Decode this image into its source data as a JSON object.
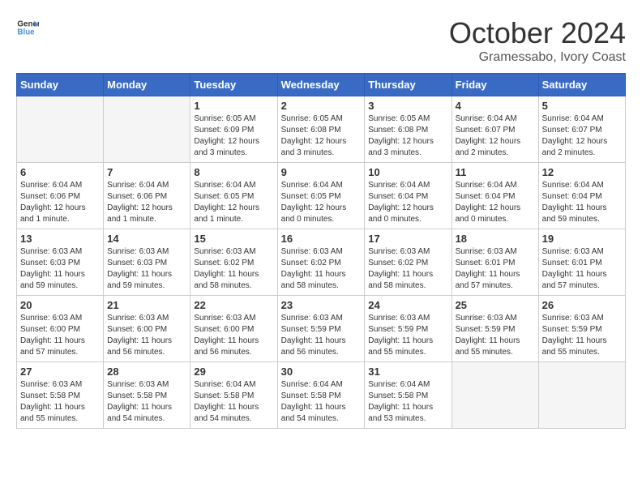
{
  "header": {
    "logo_line1": "General",
    "logo_line2": "Blue",
    "month": "October 2024",
    "location": "Gramessabo, Ivory Coast"
  },
  "weekdays": [
    "Sunday",
    "Monday",
    "Tuesday",
    "Wednesday",
    "Thursday",
    "Friday",
    "Saturday"
  ],
  "weeks": [
    [
      {
        "day": "",
        "info": ""
      },
      {
        "day": "",
        "info": ""
      },
      {
        "day": "1",
        "info": "Sunrise: 6:05 AM\nSunset: 6:09 PM\nDaylight: 12 hours\nand 3 minutes."
      },
      {
        "day": "2",
        "info": "Sunrise: 6:05 AM\nSunset: 6:08 PM\nDaylight: 12 hours\nand 3 minutes."
      },
      {
        "day": "3",
        "info": "Sunrise: 6:05 AM\nSunset: 6:08 PM\nDaylight: 12 hours\nand 3 minutes."
      },
      {
        "day": "4",
        "info": "Sunrise: 6:04 AM\nSunset: 6:07 PM\nDaylight: 12 hours\nand 2 minutes."
      },
      {
        "day": "5",
        "info": "Sunrise: 6:04 AM\nSunset: 6:07 PM\nDaylight: 12 hours\nand 2 minutes."
      }
    ],
    [
      {
        "day": "6",
        "info": "Sunrise: 6:04 AM\nSunset: 6:06 PM\nDaylight: 12 hours\nand 1 minute."
      },
      {
        "day": "7",
        "info": "Sunrise: 6:04 AM\nSunset: 6:06 PM\nDaylight: 12 hours\nand 1 minute."
      },
      {
        "day": "8",
        "info": "Sunrise: 6:04 AM\nSunset: 6:05 PM\nDaylight: 12 hours\nand 1 minute."
      },
      {
        "day": "9",
        "info": "Sunrise: 6:04 AM\nSunset: 6:05 PM\nDaylight: 12 hours\nand 0 minutes."
      },
      {
        "day": "10",
        "info": "Sunrise: 6:04 AM\nSunset: 6:04 PM\nDaylight: 12 hours\nand 0 minutes."
      },
      {
        "day": "11",
        "info": "Sunrise: 6:04 AM\nSunset: 6:04 PM\nDaylight: 12 hours\nand 0 minutes."
      },
      {
        "day": "12",
        "info": "Sunrise: 6:04 AM\nSunset: 6:04 PM\nDaylight: 11 hours\nand 59 minutes."
      }
    ],
    [
      {
        "day": "13",
        "info": "Sunrise: 6:03 AM\nSunset: 6:03 PM\nDaylight: 11 hours\nand 59 minutes."
      },
      {
        "day": "14",
        "info": "Sunrise: 6:03 AM\nSunset: 6:03 PM\nDaylight: 11 hours\nand 59 minutes."
      },
      {
        "day": "15",
        "info": "Sunrise: 6:03 AM\nSunset: 6:02 PM\nDaylight: 11 hours\nand 58 minutes."
      },
      {
        "day": "16",
        "info": "Sunrise: 6:03 AM\nSunset: 6:02 PM\nDaylight: 11 hours\nand 58 minutes."
      },
      {
        "day": "17",
        "info": "Sunrise: 6:03 AM\nSunset: 6:02 PM\nDaylight: 11 hours\nand 58 minutes."
      },
      {
        "day": "18",
        "info": "Sunrise: 6:03 AM\nSunset: 6:01 PM\nDaylight: 11 hours\nand 57 minutes."
      },
      {
        "day": "19",
        "info": "Sunrise: 6:03 AM\nSunset: 6:01 PM\nDaylight: 11 hours\nand 57 minutes."
      }
    ],
    [
      {
        "day": "20",
        "info": "Sunrise: 6:03 AM\nSunset: 6:00 PM\nDaylight: 11 hours\nand 57 minutes."
      },
      {
        "day": "21",
        "info": "Sunrise: 6:03 AM\nSunset: 6:00 PM\nDaylight: 11 hours\nand 56 minutes."
      },
      {
        "day": "22",
        "info": "Sunrise: 6:03 AM\nSunset: 6:00 PM\nDaylight: 11 hours\nand 56 minutes."
      },
      {
        "day": "23",
        "info": "Sunrise: 6:03 AM\nSunset: 5:59 PM\nDaylight: 11 hours\nand 56 minutes."
      },
      {
        "day": "24",
        "info": "Sunrise: 6:03 AM\nSunset: 5:59 PM\nDaylight: 11 hours\nand 55 minutes."
      },
      {
        "day": "25",
        "info": "Sunrise: 6:03 AM\nSunset: 5:59 PM\nDaylight: 11 hours\nand 55 minutes."
      },
      {
        "day": "26",
        "info": "Sunrise: 6:03 AM\nSunset: 5:59 PM\nDaylight: 11 hours\nand 55 minutes."
      }
    ],
    [
      {
        "day": "27",
        "info": "Sunrise: 6:03 AM\nSunset: 5:58 PM\nDaylight: 11 hours\nand 55 minutes."
      },
      {
        "day": "28",
        "info": "Sunrise: 6:03 AM\nSunset: 5:58 PM\nDaylight: 11 hours\nand 54 minutes."
      },
      {
        "day": "29",
        "info": "Sunrise: 6:04 AM\nSunset: 5:58 PM\nDaylight: 11 hours\nand 54 minutes."
      },
      {
        "day": "30",
        "info": "Sunrise: 6:04 AM\nSunset: 5:58 PM\nDaylight: 11 hours\nand 54 minutes."
      },
      {
        "day": "31",
        "info": "Sunrise: 6:04 AM\nSunset: 5:58 PM\nDaylight: 11 hours\nand 53 minutes."
      },
      {
        "day": "",
        "info": ""
      },
      {
        "day": "",
        "info": ""
      }
    ]
  ]
}
